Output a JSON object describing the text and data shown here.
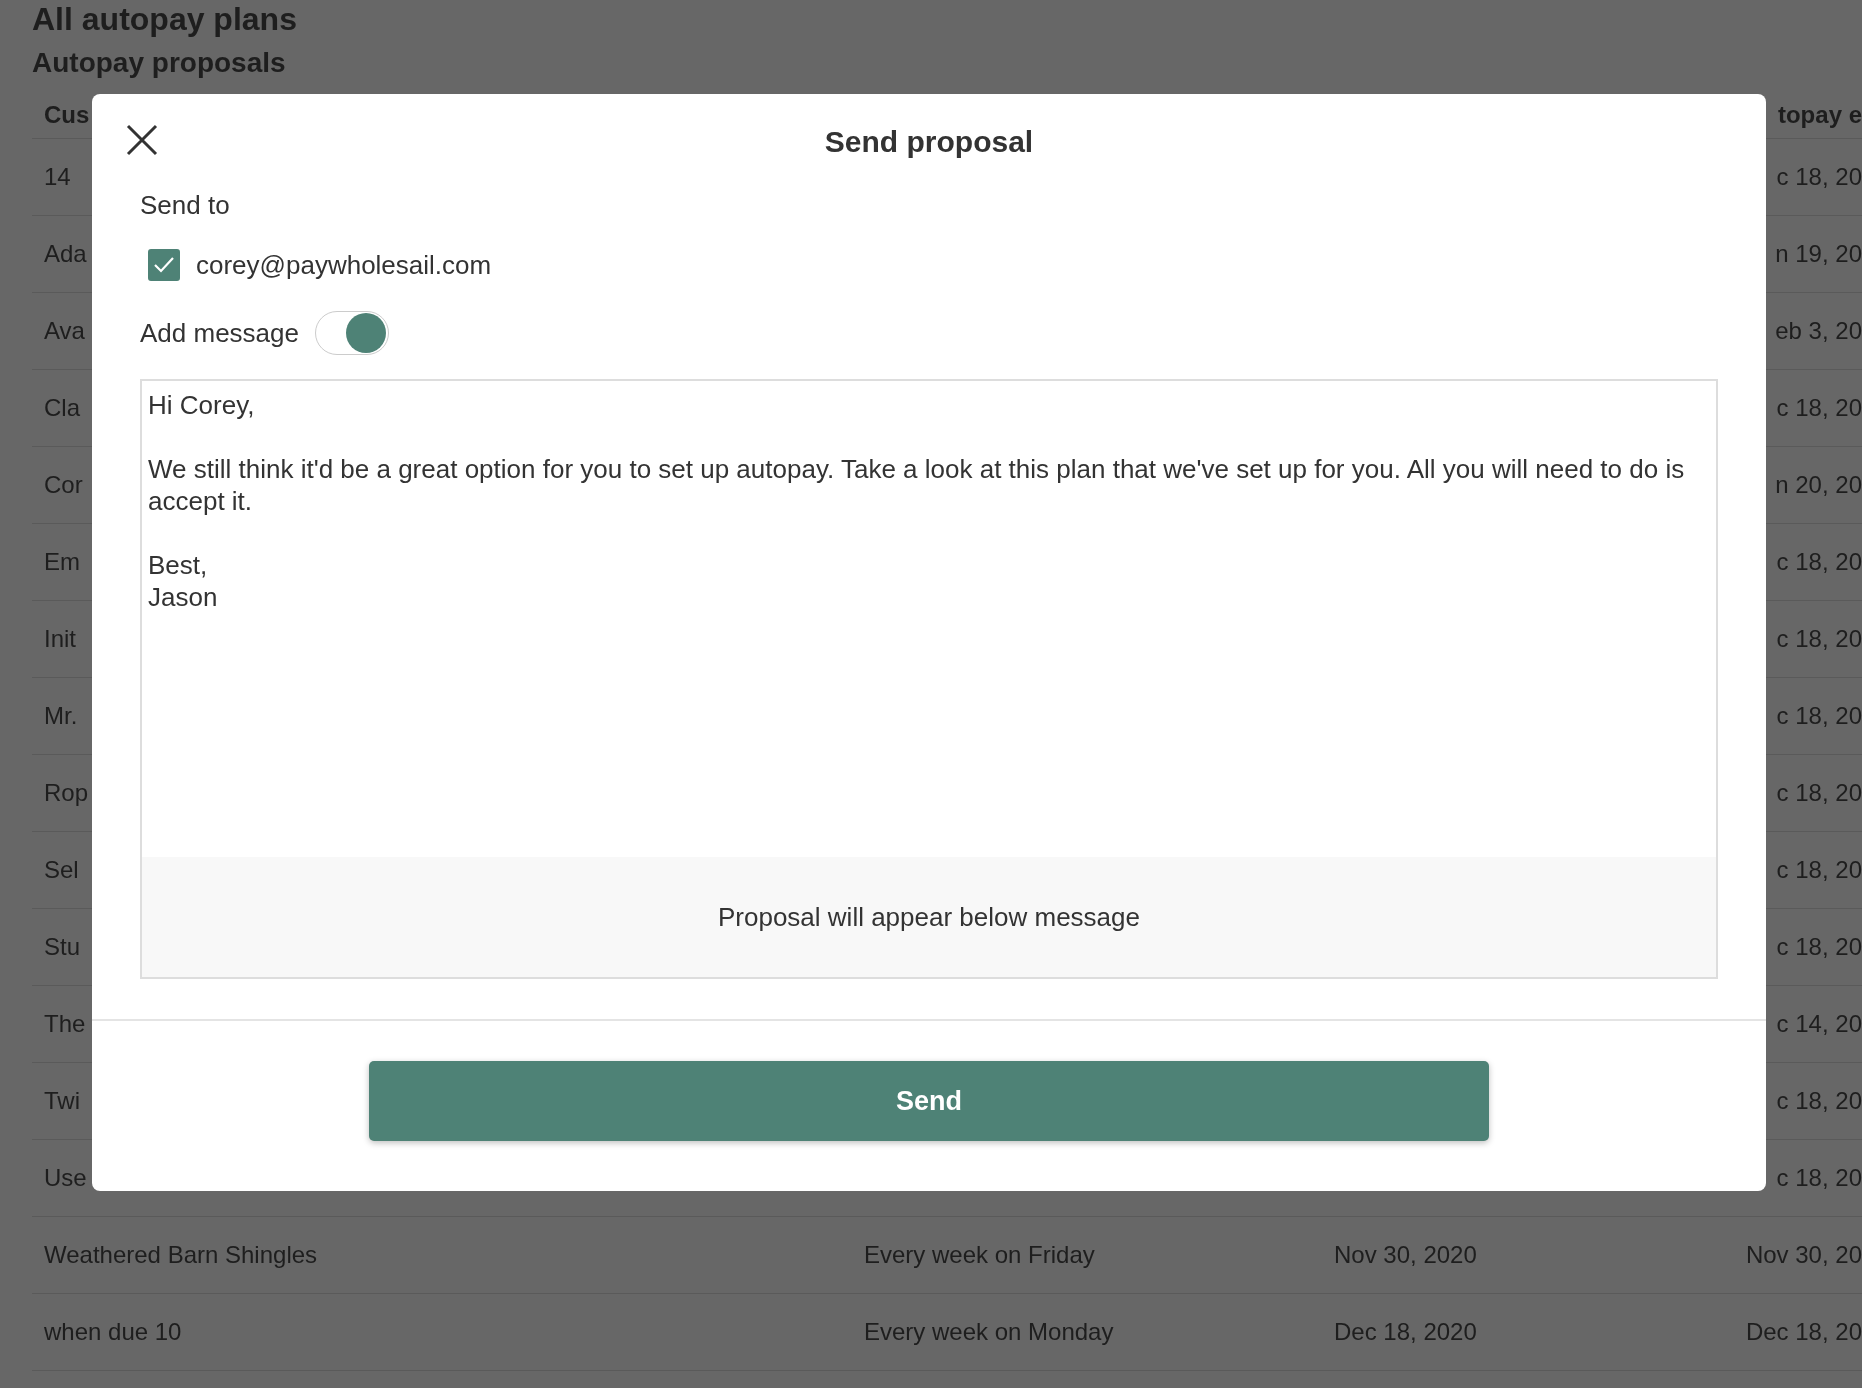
{
  "page": {
    "title": "All autopay plans",
    "section": "Autopay proposals"
  },
  "table": {
    "header": {
      "column_1": "Cus",
      "column_4": "topay e"
    },
    "rows": [
      {
        "column_1": "14",
        "column_4": "c 18, 20"
      },
      {
        "column_1": "Ada",
        "column_4": "n 19, 20"
      },
      {
        "column_1": "Ava",
        "column_4": "eb 3, 20"
      },
      {
        "column_1": "Cla",
        "column_4": "c 18, 20"
      },
      {
        "column_1": "Cor",
        "column_4": "n 20, 20"
      },
      {
        "column_1": "Em",
        "column_4": "c 18, 20"
      },
      {
        "column_1": "Init",
        "column_4": "c 18, 20"
      },
      {
        "column_1": "Mr.",
        "column_4": "c 18, 20"
      },
      {
        "column_1": "Rop",
        "column_4": "c 18, 20"
      },
      {
        "column_1": "Sel",
        "column_4": "c 18, 20"
      },
      {
        "column_1": "Stu",
        "column_4": "c 18, 20"
      },
      {
        "column_1": "The",
        "column_4": "c 14, 20"
      },
      {
        "column_1": "Twi",
        "column_4": "c 18, 20"
      },
      {
        "column_1": "Use",
        "column_4": "c 18, 20"
      },
      {
        "column_1": "Weathered Barn Shingles",
        "column_2": "Every week on Friday",
        "column_3": "Nov 30, 2020",
        "column_4": "Nov 30, 20"
      },
      {
        "column_1": "when due 10",
        "column_2": "Every week on Monday",
        "column_3": "Dec 18, 2020",
        "column_4": "Dec 18, 20"
      }
    ]
  },
  "modal": {
    "title": "Send proposal",
    "send_to_label": "Send to",
    "recipients": [
      {
        "email": "corey@paywholesail.com",
        "checked": true
      }
    ],
    "add_message": {
      "label": "Add message",
      "on": true
    },
    "message": "Hi Corey,\n\nWe still think it'd be a great option for you to set up autopay. Take a look at this plan that we've set up for you. All you will need to do is accept it.\n\nBest,\nJason",
    "note": "Proposal will appear below message",
    "send_button": "Send"
  }
}
